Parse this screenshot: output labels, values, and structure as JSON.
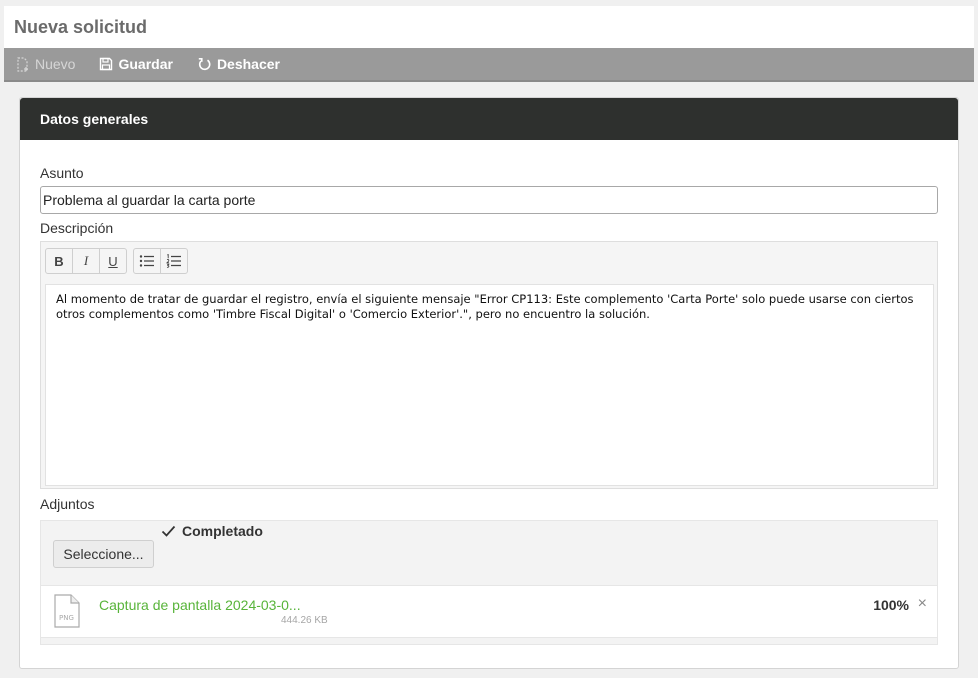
{
  "page": {
    "title": "Nueva solicitud"
  },
  "toolbar": {
    "new_label": "Nuevo",
    "save_label": "Guardar",
    "undo_label": "Deshacer"
  },
  "panel": {
    "title": "Datos generales"
  },
  "form": {
    "subject_label": "Asunto",
    "subject_value": "Problema al guardar la carta porte",
    "description_label": "Descripción",
    "description_value": "Al momento de tratar de guardar el registro, envía el siguiente mensaje \"Error CP113: Este complemento 'Carta Porte' solo puede usarse con ciertos otros complementos como 'Timbre Fiscal Digital' o 'Comercio Exterior'.\", pero no encuentro la solución.",
    "editor_tools": {
      "bold": "B",
      "italic": "I",
      "underline": "U"
    },
    "attachments_label": "Adjuntos"
  },
  "upload": {
    "select_label": "Seleccione...",
    "status": "Completado",
    "file": {
      "name": "Captura de pantalla 2024-03-0...",
      "type": "PNG",
      "size": "444.26 KB",
      "progress": "100%",
      "remove": "×"
    }
  },
  "colors": {
    "toolbar_bg": "#9a9a9a",
    "panel_header_bg": "#2e302e",
    "file_name": "#58b43a"
  }
}
